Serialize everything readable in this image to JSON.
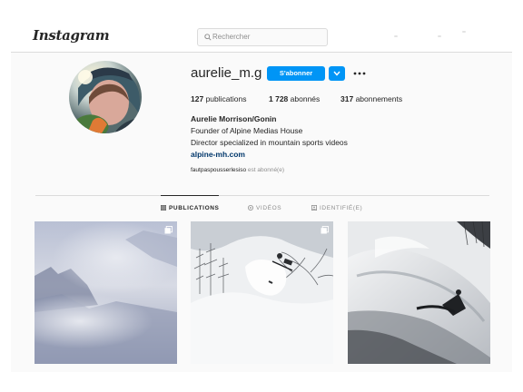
{
  "app": {
    "logo_text": "Instagram"
  },
  "search": {
    "placeholder": "Rechercher"
  },
  "profile": {
    "username": "aurelie_m.g",
    "follow_label": "S'abonner",
    "stats": [
      {
        "value": "127",
        "label": "publications"
      },
      {
        "value": "1 728",
        "label": "abonnés"
      },
      {
        "value": "317",
        "label": "abonnements"
      }
    ],
    "bio": {
      "full_name": "Aurelie Morrison/Gonin",
      "line1": "Founder of Alpine Medias House",
      "line2": "Director specialized in mountain sports videos",
      "link": "alpine-mh.com"
    },
    "followed_by": {
      "user": "fautpaspousserlesiso",
      "text": "est abonné(e)"
    }
  },
  "tabs": [
    {
      "label": "PUBLICATIONS",
      "icon": "grid-icon",
      "active": true
    },
    {
      "label": "VIDÉOS",
      "icon": "video-icon",
      "active": false
    },
    {
      "label": "IDENTIFIÉ(E)",
      "icon": "tag-icon",
      "active": false
    }
  ],
  "posts": [
    {
      "subject": "foggy mountain cliffs",
      "multi": true
    },
    {
      "subject": "skier in powder among trees",
      "multi": true
    },
    {
      "subject": "skier carving snow spray",
      "multi": false
    }
  ],
  "colors": {
    "accent": "#0095f6",
    "link": "#00376b",
    "background": "#fafafa",
    "border": "#dbdbdb"
  }
}
